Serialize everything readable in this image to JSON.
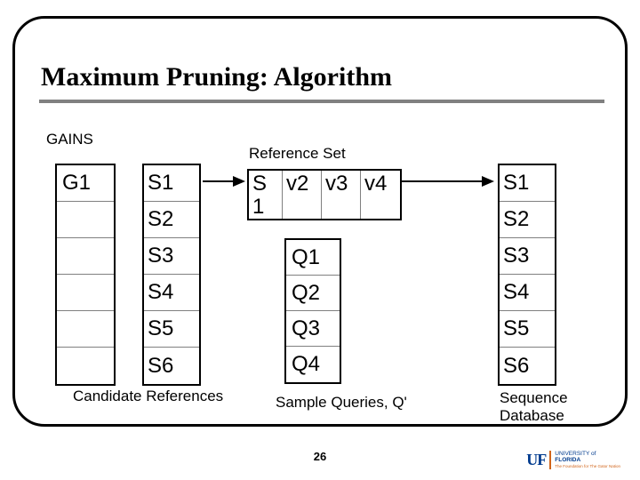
{
  "slide": {
    "title": "Maximum Pruning: Algorithm",
    "page_number": "26"
  },
  "labels": {
    "gains": "GAINS",
    "reference_set": "Reference Set",
    "candidate_refs": "Candidate References",
    "sample_queries": "Sample Queries, Q'",
    "seq_db": "Sequence\nDatabase"
  },
  "gains_cells": [
    "G1",
    "",
    "",
    "",
    "",
    ""
  ],
  "candidate_cells": [
    "S1",
    "S2",
    "S3",
    "S4",
    "S5",
    "S6"
  ],
  "ref_cells": [
    "S1",
    "v2",
    "v3",
    "v4"
  ],
  "query_cells": [
    "Q1",
    "Q2",
    "Q3",
    "Q4"
  ],
  "sequence_cells": [
    "S1",
    "S2",
    "S3",
    "S4",
    "S5",
    "S6"
  ],
  "logo": {
    "uf": "UF",
    "dept": "UNIVERSITY of",
    "name": "FLORIDA",
    "tagline": "The Foundation for The Gator Nation"
  }
}
